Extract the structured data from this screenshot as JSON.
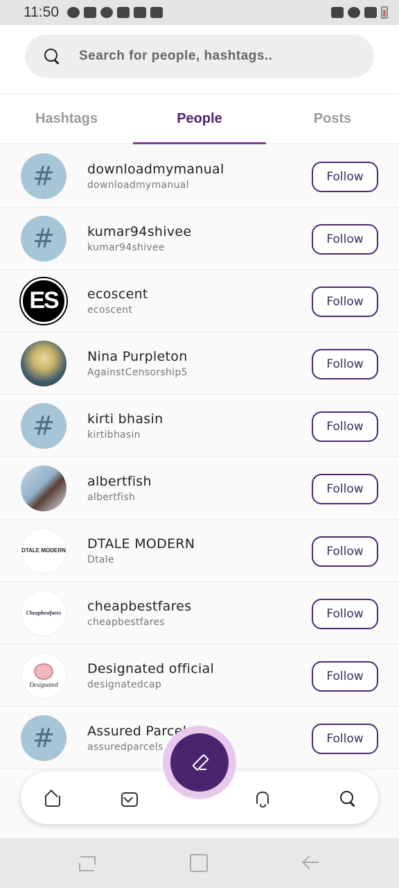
{
  "status_bar": {
    "time": "11:50",
    "left_icons": [
      "messenger-icon",
      "gmail-icon",
      "weather-icon",
      "app-icon",
      "image-icon",
      "calendar-icon"
    ],
    "right_icons": [
      "mute-icon",
      "wifi-icon",
      "signal-icon",
      "battery-icon"
    ]
  },
  "search": {
    "placeholder": "Search for people, hashtags.."
  },
  "tabs": [
    {
      "label": "Hashtags",
      "active": false
    },
    {
      "label": "People",
      "active": true
    },
    {
      "label": "Posts",
      "active": false
    }
  ],
  "people": [
    {
      "name": "downloadmymanual",
      "handle": "downloadmymanual",
      "avatar": "hashtag",
      "button": "Follow"
    },
    {
      "name": "kumar94shivee",
      "handle": "kumar94shivee",
      "avatar": "hashtag",
      "button": "Follow"
    },
    {
      "name": "ecoscent",
      "handle": "ecoscent",
      "avatar": "ES",
      "button": "Follow"
    },
    {
      "name": "Nina Purpleton",
      "handle": "AgainstCensorship5",
      "avatar": "anime-portrait",
      "button": "Follow"
    },
    {
      "name": "kirti bhasin",
      "handle": "kirtibhasin",
      "avatar": "hashtag",
      "button": "Follow"
    },
    {
      "name": "albertfish",
      "handle": "albertfish",
      "avatar": "photo-portrait",
      "button": "Follow"
    },
    {
      "name": "DTALE MODERN",
      "handle": "Dtale",
      "avatar": "logo",
      "avatar_text": "DTALE MODERN",
      "button": "Follow"
    },
    {
      "name": "cheapbestfares",
      "handle": "cheapbestfares",
      "avatar": "logo",
      "avatar_text": "Cheapbestfares",
      "button": "Follow"
    },
    {
      "name": "Designated official",
      "handle": "designatedcap",
      "avatar": "logo",
      "avatar_text": "Designated",
      "button": "Follow"
    },
    {
      "name": "Assured Parcel",
      "handle": "assuredparcels",
      "avatar": "hashtag",
      "button": "Follow"
    }
  ],
  "hash_symbol": "#",
  "es_avatar_text": "ES",
  "bottom_nav": [
    "home-icon",
    "inbox-icon",
    "bell-icon",
    "search-icon"
  ],
  "fab_icon": "pen-icon",
  "colors": {
    "accent": "#4b2470",
    "tab_underline": "#7b3f9b",
    "hashtag_avatar_bg": "#a6c5d6",
    "fab_ring": "#e7c9ec"
  }
}
